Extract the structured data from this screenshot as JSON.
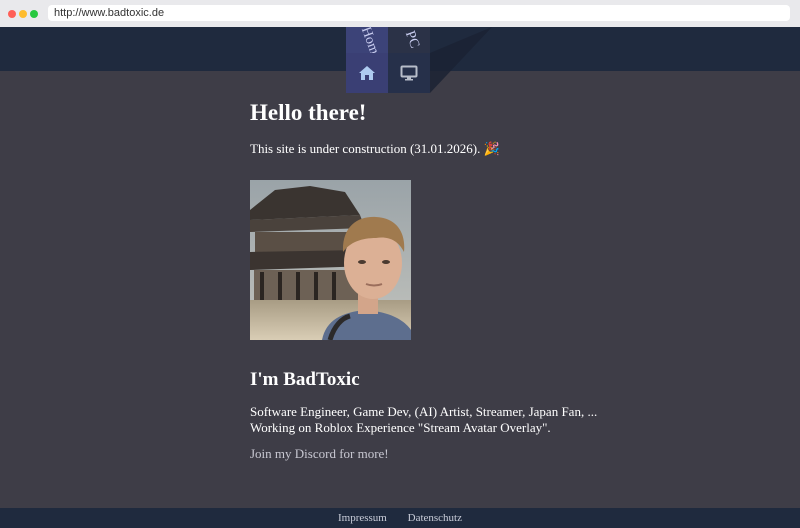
{
  "browser": {
    "url": "http://www.badtoxic.de"
  },
  "nav": {
    "home_label": "Home",
    "pc_label": "PC",
    "home_icon": "home-icon",
    "pc_icon": "monitor-icon",
    "accent": "#3a3f74"
  },
  "main": {
    "heading": "Hello there!",
    "construction": "This site is under construction (31.01.2026). 🎉",
    "about_heading": "I'm BadToxic",
    "about_line1": "Software Engineer, Game Dev, (AI) Artist, Streamer, Japan Fan, ...",
    "about_line2": "Working on Roblox Experience \"Stream Avatar Overlay\".",
    "discord_link": "Join my Discord for more!"
  },
  "footer": {
    "impressum": "Impressum",
    "datenschutz": "Datenschutz"
  }
}
